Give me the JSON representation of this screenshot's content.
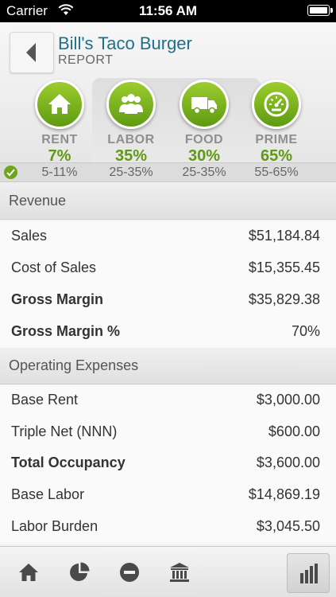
{
  "status_bar": {
    "carrier": "Carrier",
    "time": "11:56 AM"
  },
  "header": {
    "back_icon": "chevron-left-icon",
    "title": "Bill's Taco Burger",
    "subtitle": "REPORT"
  },
  "metrics": [
    {
      "icon": "house-icon",
      "label": "RENT",
      "value": "7%",
      "range": "5-11%"
    },
    {
      "icon": "people-icon",
      "label": "LABOR",
      "value": "35%",
      "range": "25-35%"
    },
    {
      "icon": "truck-icon",
      "label": "FOOD",
      "value": "30%",
      "range": "25-35%"
    },
    {
      "icon": "gauge-icon",
      "label": "PRIME",
      "value": "65%",
      "range": "55-65%"
    }
  ],
  "accent_color": "#6ea51d",
  "sections": [
    {
      "title": "Revenue",
      "rows": [
        {
          "label": "Sales",
          "value": "$51,184.84"
        },
        {
          "label": "Cost of Sales",
          "value": "$15,355.45"
        },
        {
          "label": "Gross Margin",
          "value": "$35,829.38"
        },
        {
          "label": "Gross Margin %",
          "value": "70%"
        }
      ]
    },
    {
      "title": "Operating Expenses",
      "rows": [
        {
          "label": "Base Rent",
          "value": "$3,000.00"
        },
        {
          "label": "Triple Net (NNN)",
          "value": "$600.00"
        },
        {
          "label": "Total Occupancy",
          "value": "$3,600.00"
        },
        {
          "label": "Base Labor",
          "value": "$14,869.19"
        },
        {
          "label": "Labor Burden",
          "value": "$3,045.50"
        }
      ]
    }
  ],
  "toolbar": [
    "home-icon",
    "pie-chart-icon",
    "minus-circle-icon",
    "bank-icon",
    "bar-chart-icon"
  ]
}
